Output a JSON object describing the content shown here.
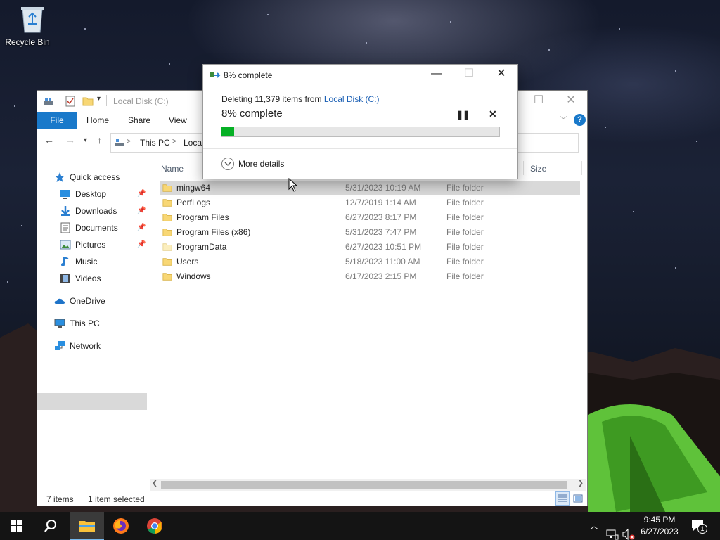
{
  "desktop": {
    "recycle_bin_label": "Recycle Bin"
  },
  "explorer": {
    "title": "Local Disk (C:)",
    "ribbon_tabs": [
      "File",
      "Home",
      "Share",
      "View"
    ],
    "help_label": "?",
    "address": {
      "crumbs": [
        "This PC",
        "Local"
      ],
      "separator": ">"
    },
    "sidebar": {
      "quick_access": "Quick access",
      "items": [
        {
          "label": "Desktop",
          "icon": "desktop-icon",
          "pinned": true
        },
        {
          "label": "Downloads",
          "icon": "downloads-icon",
          "pinned": true
        },
        {
          "label": "Documents",
          "icon": "documents-icon",
          "pinned": true
        },
        {
          "label": "Pictures",
          "icon": "pictures-icon",
          "pinned": true
        },
        {
          "label": "Music",
          "icon": "music-icon",
          "pinned": false
        },
        {
          "label": "Videos",
          "icon": "videos-icon",
          "pinned": false
        }
      ],
      "onedrive": "OneDrive",
      "this_pc": "This PC",
      "network": "Network"
    },
    "columns": {
      "name": "Name",
      "size": "Size"
    },
    "files": [
      {
        "name": "mingw64",
        "date": "5/31/2023 10:19 AM",
        "type": "File folder",
        "selected": true
      },
      {
        "name": "PerfLogs",
        "date": "12/7/2019 1:14 AM",
        "type": "File folder",
        "selected": false
      },
      {
        "name": "Program Files",
        "date": "6/27/2023 8:17 PM",
        "type": "File folder",
        "selected": false
      },
      {
        "name": "Program Files (x86)",
        "date": "5/31/2023 7:47 PM",
        "type": "File folder",
        "selected": false
      },
      {
        "name": "ProgramData",
        "date": "6/27/2023 10:51 PM",
        "type": "File folder",
        "selected": false
      },
      {
        "name": "Users",
        "date": "5/18/2023 11:00 AM",
        "type": "File folder",
        "selected": false
      },
      {
        "name": "Windows",
        "date": "6/17/2023 2:15 PM",
        "type": "File folder",
        "selected": false
      }
    ],
    "status": {
      "items_count": "7 items",
      "selected": "1 item selected"
    }
  },
  "progress_dialog": {
    "title": "8% complete",
    "description_prefix": "Deleting 11,379 items from ",
    "description_link": "Local Disk (C:)",
    "percent_text": "8% complete",
    "progress_fraction": 0.045,
    "more_details": "More details",
    "accent_color": "#06b025"
  },
  "taskbar": {
    "time": "9:45 PM",
    "date": "6/27/2023",
    "notification_count": "1",
    "apps": [
      "start-icon",
      "search-icon",
      "file-explorer-icon",
      "firefox-icon",
      "chrome-icon"
    ]
  }
}
